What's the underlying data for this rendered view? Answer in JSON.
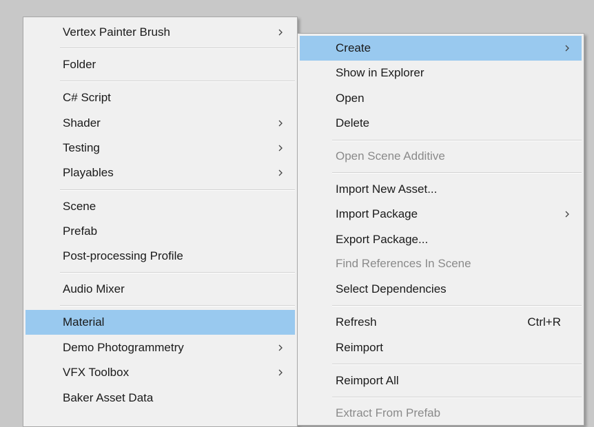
{
  "left_menu": {
    "items": [
      {
        "label": "Vertex Painter Brush",
        "submenu": true
      },
      {
        "label": "Folder"
      },
      {
        "label": "C# Script"
      },
      {
        "label": "Shader",
        "submenu": true
      },
      {
        "label": "Testing",
        "submenu": true
      },
      {
        "label": "Playables",
        "submenu": true
      },
      {
        "label": "Scene"
      },
      {
        "label": "Prefab"
      },
      {
        "label": "Post-processing Profile"
      },
      {
        "label": "Audio Mixer"
      },
      {
        "label": "Material",
        "highlighted": true
      },
      {
        "label": "Demo Photogrammetry",
        "submenu": true
      },
      {
        "label": "VFX Toolbox",
        "submenu": true
      },
      {
        "label": "Baker Asset Data"
      }
    ]
  },
  "right_menu": {
    "items": [
      {
        "label": "Create",
        "submenu": true,
        "highlighted": true
      },
      {
        "label": "Show in Explorer"
      },
      {
        "label": "Open"
      },
      {
        "label": "Delete"
      },
      {
        "label": "Open Scene Additive",
        "disabled": true
      },
      {
        "label": "Import New Asset..."
      },
      {
        "label": "Import Package",
        "submenu": true
      },
      {
        "label": "Export Package..."
      },
      {
        "label": "Find References In Scene",
        "disabled": true
      },
      {
        "label": "Select Dependencies"
      },
      {
        "label": "Refresh",
        "shortcut": "Ctrl+R"
      },
      {
        "label": "Reimport"
      },
      {
        "label": "Reimport All"
      },
      {
        "label": "Extract From Prefab",
        "disabled": true
      }
    ]
  },
  "colors": {
    "highlight": "#99c9ef",
    "menu_background": "#f0f0f0",
    "disabled_text": "#8a8a8a",
    "desktop_background": "#c8c8c8"
  },
  "icons": {
    "submenu": "chevron-right-icon"
  }
}
